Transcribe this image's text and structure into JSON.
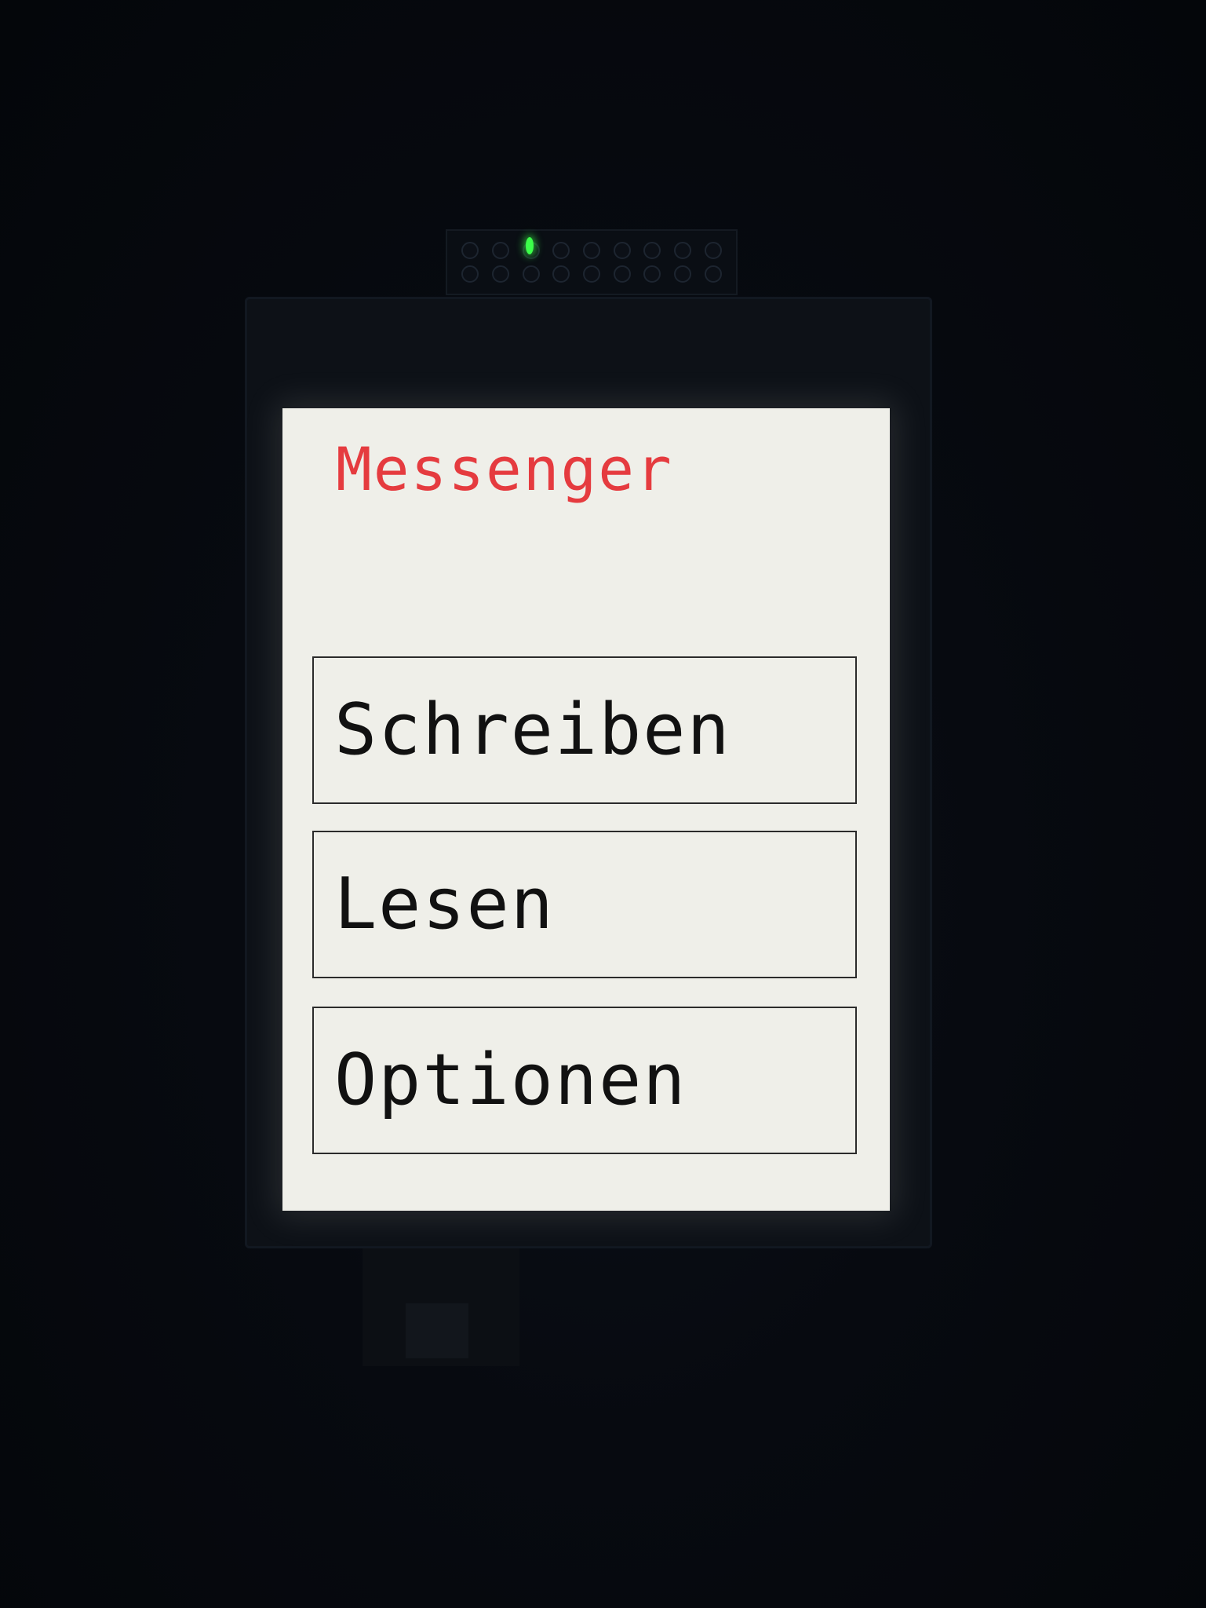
{
  "colors": {
    "title": "#e53b3f",
    "button_text": "#111111",
    "button_border": "#2b2b2b",
    "screen_background": "#efefe9",
    "led": "#3cff4a"
  },
  "screen": {
    "title": "Messenger"
  },
  "menu": {
    "items": [
      {
        "label": "Schreiben"
      },
      {
        "label": "Lesen"
      },
      {
        "label": "Optionen"
      }
    ]
  }
}
